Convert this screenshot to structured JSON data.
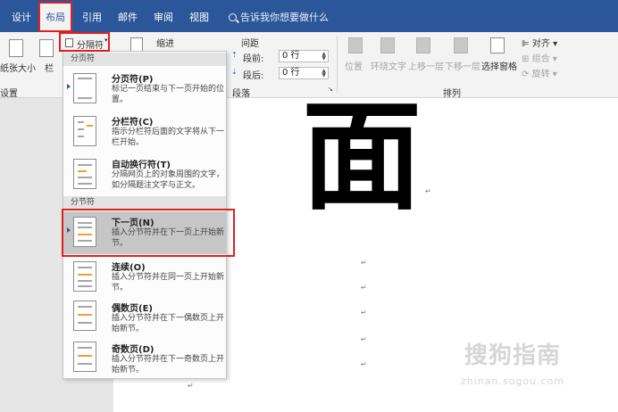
{
  "tabs": [
    {
      "label": "设计"
    },
    {
      "label": "布局"
    },
    {
      "label": "引用"
    },
    {
      "label": "邮件"
    },
    {
      "label": "审阅"
    },
    {
      "label": "视图"
    }
  ],
  "tell_me": "告诉我你想要做什么",
  "ribbon": {
    "paper_size": "纸张大小",
    "columns": "栏",
    "breaks_button": "分隔符",
    "indent_label": "缩进",
    "spacing_label": "间距",
    "before_label": "段前:",
    "before_value": "0 行",
    "after_label": "段后:",
    "after_value": "0 行",
    "group_page_setup": "设置",
    "group_paragraph": "段落",
    "group_arrange": "排列",
    "position": "位置",
    "wrap_text": "环绕文字",
    "bring_forward": "上移一层",
    "send_backward": "下移一层",
    "selection_pane": "选择窗格",
    "align": "对齐",
    "group": "组合",
    "rotate": "旋转"
  },
  "menu": {
    "section_page": "分页符",
    "section_section": "分节符",
    "items": [
      {
        "title": "分页符(P)",
        "desc": "标记一页结束与下一页开始的位置。"
      },
      {
        "title": "分栏符(C)",
        "desc": "指示分栏符后面的文字将从下一栏开始。"
      },
      {
        "title": "自动换行符(T)",
        "desc": "分隔网页上的对象周围的文字，如分隔题注文字与正文。"
      },
      {
        "title": "下一页(N)",
        "desc": "插入分节符并在下一页上开始新节。"
      },
      {
        "title": "连续(O)",
        "desc": "插入分节符并在同一页上开始新节。"
      },
      {
        "title": "偶数页(E)",
        "desc": "插入分节符并在下一偶数页上开始新节。"
      },
      {
        "title": "奇数页(D)",
        "desc": "插入分节符并在下一奇数页上开始新节。"
      }
    ]
  },
  "document": {
    "big_char": "面",
    "para_mark": "↵"
  },
  "watermark": {
    "text": "搜狗指南",
    "url": "zhinan.sogou.com"
  },
  "colors": {
    "accent": "#2b579a",
    "highlight_red": "#e02020",
    "menu_selected": "#c6c6c6"
  }
}
